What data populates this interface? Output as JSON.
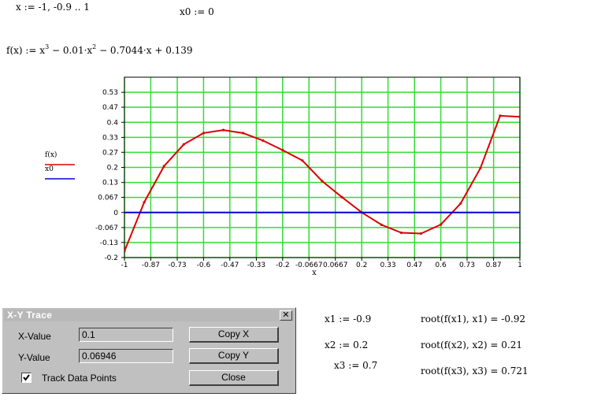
{
  "worksheet": {
    "range_def": "x := -1, -0.9 .. 1",
    "x0_def": "x0 := 0",
    "function_def": {
      "lhs": "f(x) := x",
      "exp": "3",
      "rest": " − 0.01·x",
      "exp2": "2",
      "rest2": " − 0.7044·x + 0.139"
    },
    "guesses": [
      "x1 := -0.9",
      "x2 := 0.2",
      "x3 := 0.7"
    ],
    "roots": [
      "root(f(x1), x1) = -0.92",
      "root(f(x2), x2) = 0.21",
      "root(f(x3), x3) = 0.721"
    ]
  },
  "chart_data": {
    "type": "line",
    "x_range": [
      -1,
      1
    ],
    "y_range": [
      -0.2,
      0.6
    ],
    "xlabel": "x",
    "x_ticks": [
      "-1",
      "-0.87",
      "-0.73",
      "-0.6",
      "-0.47",
      "-0.33",
      "-0.2",
      "-0.0667",
      "0.0667",
      "0.2",
      "0.33",
      "0.47",
      "0.6",
      "0.73",
      "0.87",
      "1"
    ],
    "x_tick_values": [
      -1,
      -0.867,
      -0.733,
      -0.6,
      -0.467,
      -0.333,
      -0.2,
      -0.0667,
      0.0667,
      0.2,
      0.333,
      0.467,
      0.6,
      0.733,
      0.867,
      1
    ],
    "y_ticks": [
      "0.53",
      "0.47",
      "0.4",
      "0.33",
      "0.27",
      "0.2",
      "0.13",
      "0.067",
      "0",
      "-0.067",
      "-0.13",
      "-0.2"
    ],
    "y_tick_values": [
      0.533,
      0.467,
      0.4,
      0.333,
      0.267,
      0.2,
      0.133,
      0.067,
      0,
      -0.067,
      -0.133,
      -0.2
    ],
    "grid": true,
    "grid_color": "#33dd33",
    "legend_placement": "left",
    "series": [
      {
        "name": "f(x)",
        "color": "#dd0000",
        "x": [
          -1,
          -0.9,
          -0.8,
          -0.7,
          -0.6,
          -0.5,
          -0.4,
          -0.3,
          -0.2,
          -0.1,
          0,
          0.1,
          0.2,
          0.3,
          0.4,
          0.5,
          0.6,
          0.7,
          0.8,
          0.9,
          1
        ],
        "y": [
          -0.1716,
          0.0455,
          0.2052,
          0.302,
          0.3522,
          0.3657,
          0.352,
          0.3193,
          0.2766,
          0.2303,
          0.139,
          0.0679,
          0.0001,
          -0.0548,
          -0.09,
          -0.0934,
          -0.0537,
          0.0396,
          0.1963,
          0.4289,
          0.4246
        ]
      },
      {
        "name": "x0",
        "color": "#0000cc",
        "x": [
          -1,
          1
        ],
        "y": [
          0,
          0
        ]
      }
    ]
  },
  "trace": {
    "title": "X-Y Trace",
    "x_label": "X-Value",
    "x_value": "0.1",
    "y_label": "Y-Value",
    "y_value": "0.06946",
    "copy_x": "Copy X",
    "copy_y": "Copy Y",
    "track_label": "Track Data Points",
    "track_checked": true,
    "close": "Close",
    "close_glyph": "✕"
  }
}
